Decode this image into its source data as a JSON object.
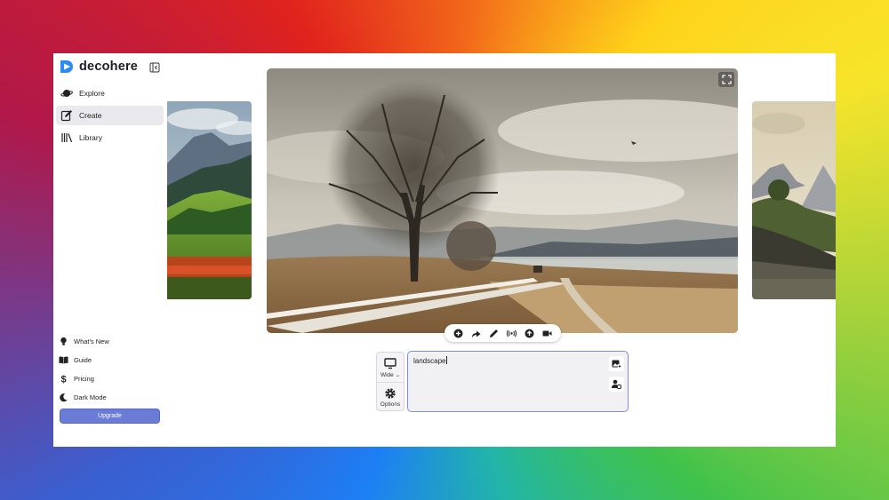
{
  "app": {
    "name": "decohere"
  },
  "nav": {
    "items": [
      {
        "label": "Explore",
        "icon": "planet-icon",
        "active": false
      },
      {
        "label": "Create",
        "icon": "edit-icon",
        "active": true
      },
      {
        "label": "Library",
        "icon": "library-icon",
        "active": false
      }
    ]
  },
  "bottom_links": [
    {
      "label": "What's New",
      "icon": "lightbulb-icon"
    },
    {
      "label": "Guide",
      "icon": "book-icon"
    },
    {
      "label": "Pricing",
      "icon": "dollar-icon"
    },
    {
      "label": "Dark Mode",
      "icon": "moon-icon"
    }
  ],
  "upgrade_label": "Upgrade",
  "controls": {
    "aspect_label": "Wide",
    "options_label": "Options"
  },
  "prompt": {
    "value": "landscape"
  },
  "colors": {
    "accent": "#6b7cd6",
    "prompt_border": "#7f8de0"
  },
  "toolbar_icons": [
    "add-circle-icon",
    "share-arrow-icon",
    "pencil-icon",
    "broadcast-icon",
    "upload-icon",
    "video-icon"
  ]
}
